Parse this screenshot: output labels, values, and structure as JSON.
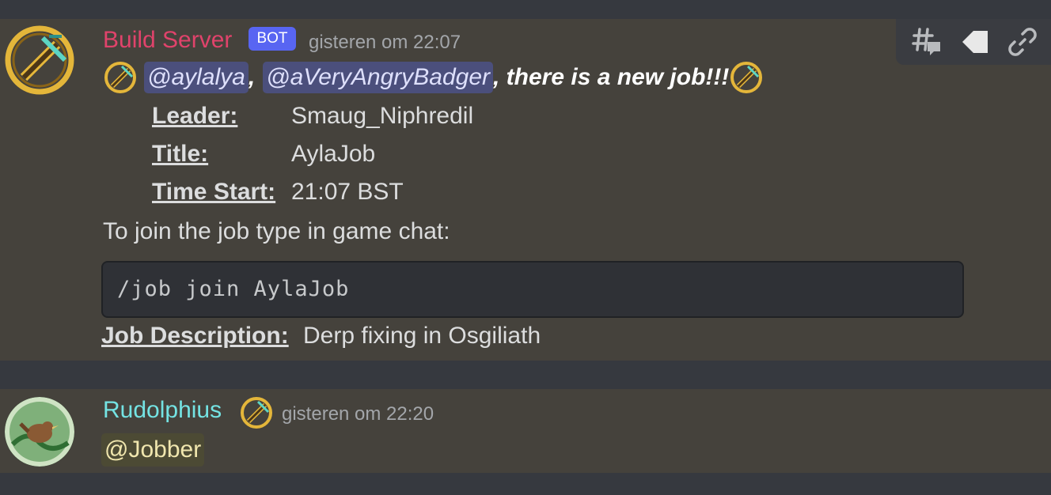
{
  "messages": [
    {
      "author": "Build Server",
      "bot_badge": "BOT",
      "timestamp": "gisteren om 22:07",
      "mentions": [
        "@aylalya",
        "@aVeryAngryBadger"
      ],
      "separator": ",",
      "headline_suffix": ", there is a new job!!!",
      "fields": [
        {
          "label": "Leader:",
          "value": "Smaug_Niphredil"
        },
        {
          "label": "Title:",
          "value": "AylaJob"
        },
        {
          "label": "Time Start:",
          "value": "21:07 BST"
        }
      ],
      "instruction": "To join the job type in game chat:",
      "code": "/job join AylaJob",
      "description_label": "Job Description:",
      "description_value": "Derp fixing in Osgiliath"
    },
    {
      "author": "Rudolphius",
      "timestamp": "gisteren om 22:20",
      "mention": "@Jobber"
    }
  ],
  "toolbar": {
    "icons": [
      "threads-icon",
      "tag-icon",
      "link-icon"
    ]
  },
  "colors": {
    "bot_name": "#e0436b",
    "user_name": "#74e3e3",
    "bot_badge": "#5865f2",
    "mention_bg": "#4b4f7c",
    "message_bg": "#45423c"
  }
}
